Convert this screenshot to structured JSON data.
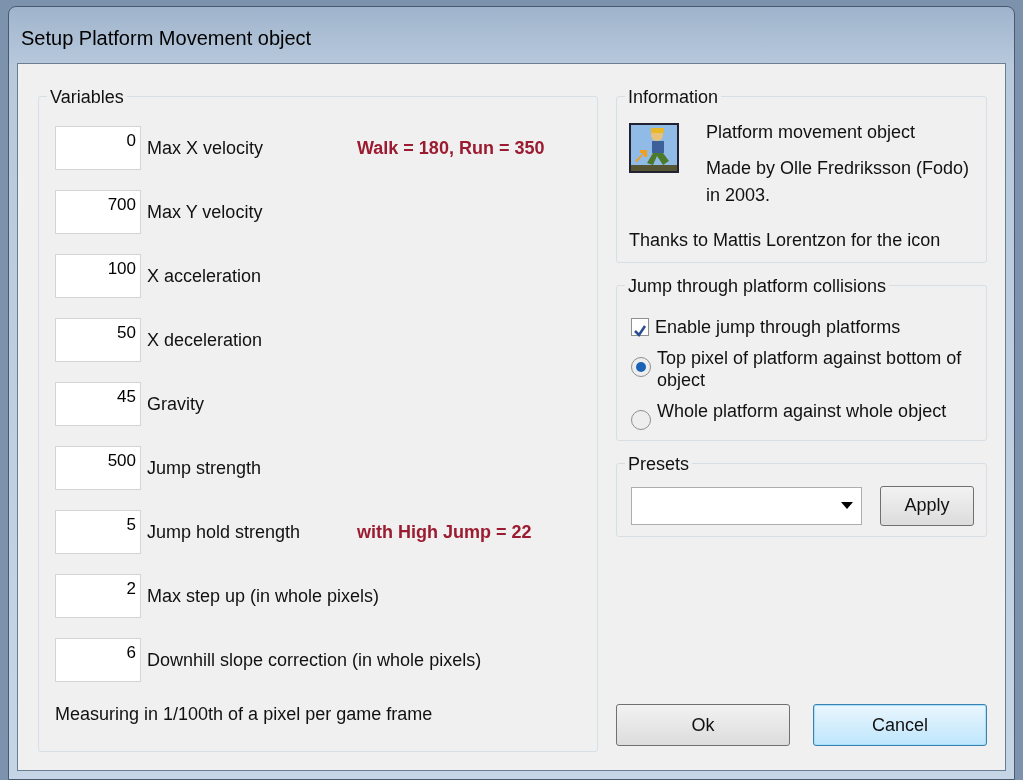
{
  "window": {
    "title": "Setup Platform Movement object"
  },
  "variables": {
    "title": "Variables",
    "rows": [
      {
        "value": "0",
        "label": "Max X velocity",
        "note": "Walk = 180, Run = 350"
      },
      {
        "value": "700",
        "label": "Max Y velocity"
      },
      {
        "value": "100",
        "label": "X acceleration"
      },
      {
        "value": "50",
        "label": "X deceleration"
      },
      {
        "value": "45",
        "label": "Gravity"
      },
      {
        "value": "500",
        "label": "Jump strength"
      },
      {
        "value": "5",
        "label": "Jump hold strength",
        "note": "with High Jump = 22"
      },
      {
        "value": "2",
        "label": "Max step up (in whole pixels)"
      },
      {
        "value": "6",
        "label": "Downhill slope correction (in whole pixels)"
      }
    ],
    "footer": "Measuring in 1/100th of a pixel per game frame"
  },
  "information": {
    "title": "Information",
    "lines": [
      "Platform movement object",
      "Made by Olle Fredriksson (Fodo) in 2003."
    ],
    "thanks": "Thanks to Mattis Lorentzon for the icon"
  },
  "jump": {
    "title": "Jump through platform collisions",
    "checkbox": {
      "label": "Enable jump through platforms",
      "checked": true
    },
    "options": [
      {
        "label": "Top pixel of platform against bottom of object",
        "selected": true
      },
      {
        "label": "Whole platform against whole object",
        "selected": false
      }
    ]
  },
  "presets": {
    "title": "Presets",
    "apply": "Apply"
  },
  "buttons": [
    {
      "label": "Ok",
      "default": false
    },
    {
      "label": "Cancel",
      "default": true
    }
  ]
}
